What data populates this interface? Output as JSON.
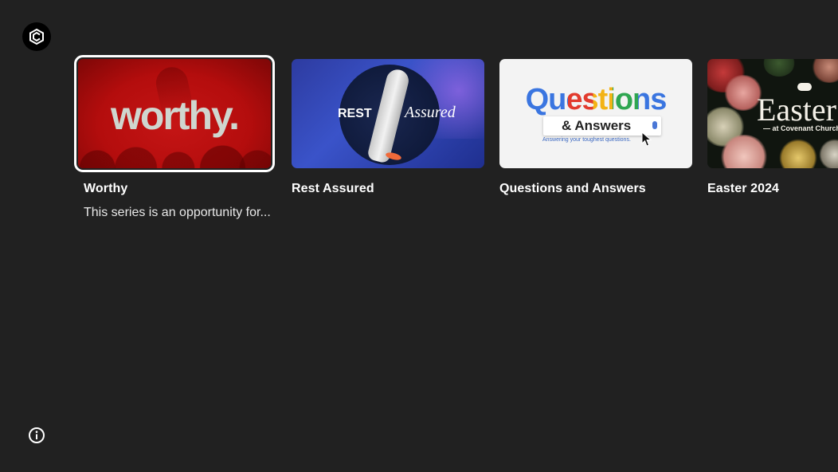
{
  "app": {
    "logo_icon": "church-app-logo-icon",
    "info_icon": "info-icon"
  },
  "series": [
    {
      "title": "Worthy",
      "description": "This series is an opportunity for...",
      "selected": true,
      "thumbnail_text": "worthy."
    },
    {
      "title": "Rest Assured",
      "description": "",
      "selected": false,
      "thumbnail_text_1": "REST",
      "thumbnail_text_2": "Assured"
    },
    {
      "title": "Questions and Answers",
      "description": "",
      "selected": false,
      "thumbnail_text_1": "Questions",
      "thumbnail_text_2": "& Answers",
      "thumbnail_subtext": "Answering your toughest questions."
    },
    {
      "title": "Easter 2024",
      "description": "",
      "selected": false,
      "thumbnail_text_1": "Easter",
      "thumbnail_subtext": "— at Covenant Church —"
    }
  ],
  "colors": {
    "background": "#212121",
    "selection_outline": "#ffffff"
  }
}
